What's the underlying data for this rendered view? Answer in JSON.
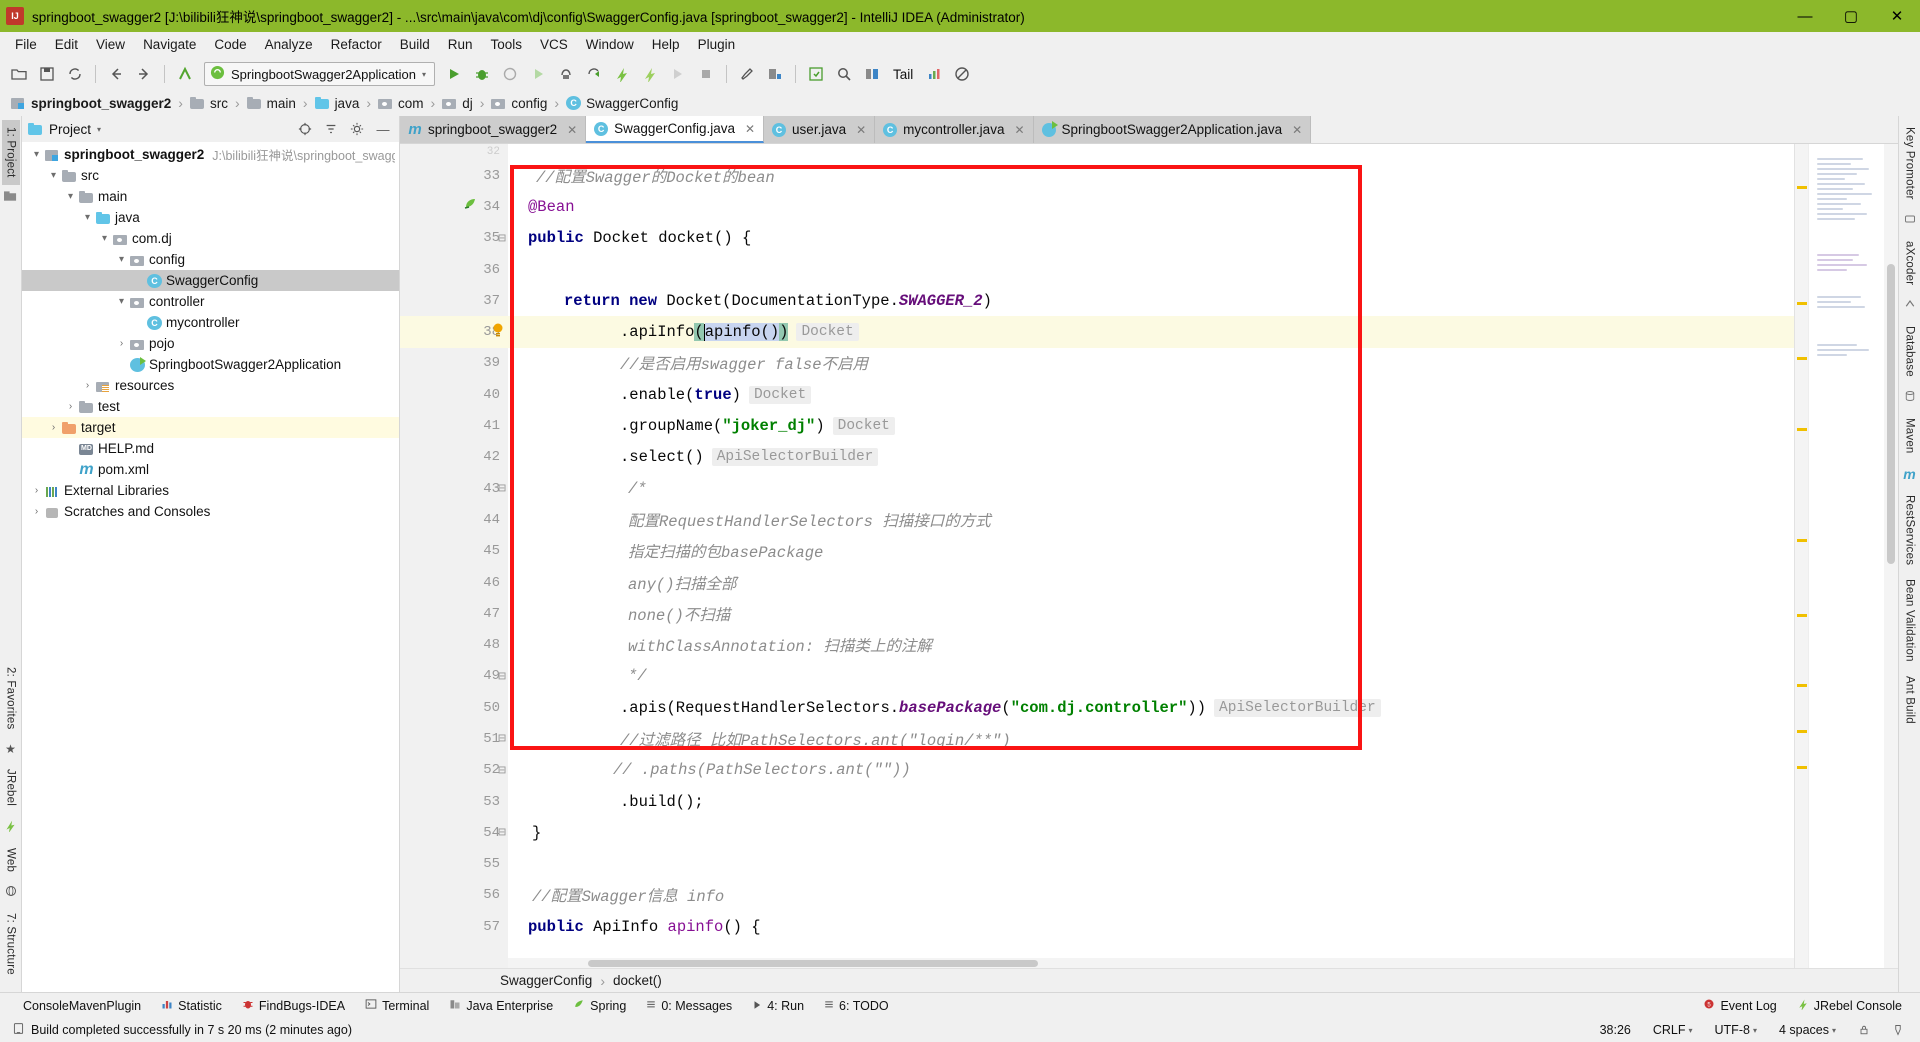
{
  "window": {
    "title": "springboot_swagger2 [J:\\bilibili狂神说\\springboot_swagger2] - ...\\src\\main\\java\\com\\dj\\config\\SwaggerConfig.java [springboot_swagger2] - IntelliJ IDEA (Administrator)",
    "minimize": "—",
    "maximize": "▢",
    "close": "✕",
    "app_icon": "intellij-idea-icon"
  },
  "menubar": {
    "items": [
      "File",
      "Edit",
      "View",
      "Navigate",
      "Code",
      "Analyze",
      "Refactor",
      "Build",
      "Run",
      "Tools",
      "VCS",
      "Window",
      "Help",
      "Plugin"
    ]
  },
  "toolbar": {
    "open_icon": "open-folder-icon",
    "save_icon": "save-icon",
    "sync_icon": "sync-icon",
    "back_icon": "back-arrow-icon",
    "forward_icon": "forward-arrow-icon",
    "revert_icon": "revert-icon",
    "run_config": "SpringbootSwagger2Application",
    "run_config_icon": "spring-boot-icon",
    "run_config_chevron": "chevron-down-icon",
    "run_icon": "run-icon",
    "debug_icon": "debug-icon",
    "run_coverage_icon": "run-with-coverage-icon",
    "profile_icon": "profile-icon",
    "attach_icon": "attach-debugger-icon",
    "rerun_icon": "rerun-icon",
    "jrebel_run_icon": "jrebel-run-icon",
    "jrebel_debug_icon": "jrebel-debug-icon",
    "stop_gray_icon": "stop-disabled-icon",
    "stop_icon": "stop-icon",
    "settings_icon": "settings-wrench-icon",
    "project_structure_icon": "project-structure-icon",
    "update_icon": "update-project-icon",
    "search_icon": "search-everywhere-icon",
    "compare_icon": "compare-icon",
    "tail_label": "Tail",
    "chart_icon": "chart-icon",
    "block_icon": "no-entry-icon"
  },
  "breadcrumb": {
    "items": [
      {
        "label": "springboot_swagger2",
        "icon": "module-icon"
      },
      {
        "label": "src",
        "icon": "folder-icon"
      },
      {
        "label": "main",
        "icon": "folder-icon"
      },
      {
        "label": "java",
        "icon": "source-folder-icon"
      },
      {
        "label": "com",
        "icon": "package-icon"
      },
      {
        "label": "dj",
        "icon": "package-icon"
      },
      {
        "label": "config",
        "icon": "package-icon"
      },
      {
        "label": "SwaggerConfig",
        "icon": "class-icon"
      }
    ],
    "separator": "›"
  },
  "left_rail": {
    "items": [
      "1: Project",
      "2: Favorites",
      "7: Structure"
    ],
    "icons": [
      "project-icon",
      "star-icon",
      "structure-icon",
      "jrebel-icon",
      "web-icon"
    ]
  },
  "right_rail": {
    "items": [
      "Key Promoter",
      "aXcoder",
      "Database",
      "Maven",
      "RestServices",
      "Bean Validation",
      "Ant Build"
    ]
  },
  "project_panel": {
    "title": "Project",
    "title_chevron": "chevron-down-icon",
    "title_icon": "project-view-icon",
    "locate_icon": "scroll-from-source-icon",
    "collapse_icon": "collapse-all-icon",
    "settings_icon": "gear-icon",
    "hide_icon": "hide-icon",
    "tree": [
      {
        "label": "springboot_swagger2",
        "path": "J:\\bilibili狂神说\\springboot_swagg",
        "indent": 0,
        "twisty": "▾",
        "icon": "module-icon",
        "bold": true,
        "state": "normal"
      },
      {
        "label": "src",
        "indent": 1,
        "twisty": "▾",
        "icon": "folder-icon",
        "state": "normal"
      },
      {
        "label": "main",
        "indent": 2,
        "twisty": "▾",
        "icon": "folder-icon",
        "state": "normal"
      },
      {
        "label": "java",
        "indent": 3,
        "twisty": "▾",
        "icon": "source-folder-icon",
        "state": "normal"
      },
      {
        "label": "com.dj",
        "indent": 4,
        "twisty": "▾",
        "icon": "package-icon",
        "state": "normal"
      },
      {
        "label": "config",
        "indent": 5,
        "twisty": "▾",
        "icon": "package-icon",
        "state": "normal"
      },
      {
        "label": "SwaggerConfig",
        "indent": 6,
        "twisty": "",
        "icon": "class-icon",
        "state": "selected"
      },
      {
        "label": "controller",
        "indent": 5,
        "twisty": "▾",
        "icon": "package-icon",
        "state": "normal"
      },
      {
        "label": "mycontroller",
        "indent": 6,
        "twisty": "",
        "icon": "class-icon",
        "state": "normal"
      },
      {
        "label": "pojo",
        "indent": 5,
        "twisty": "›",
        "icon": "package-icon",
        "state": "normal"
      },
      {
        "label": "SpringbootSwagger2Application",
        "indent": 5,
        "twisty": "",
        "icon": "spring-class-icon",
        "state": "normal"
      },
      {
        "label": "resources",
        "indent": 3,
        "twisty": "›",
        "icon": "resources-folder-icon",
        "state": "normal"
      },
      {
        "label": "test",
        "indent": 2,
        "twisty": "›",
        "icon": "folder-icon",
        "state": "normal"
      },
      {
        "label": "target",
        "indent": 1,
        "twisty": "›",
        "icon": "folder-orange-icon",
        "state": "highlighted"
      },
      {
        "label": "HELP.md",
        "indent": 2,
        "twisty": "",
        "icon": "markdown-icon",
        "state": "normal"
      },
      {
        "label": "pom.xml",
        "indent": 2,
        "twisty": "",
        "icon": "maven-icon",
        "state": "normal"
      },
      {
        "label": "External Libraries",
        "indent": 0,
        "twisty": "›",
        "icon": "libraries-icon",
        "state": "normal"
      },
      {
        "label": "Scratches and Consoles",
        "indent": 0,
        "twisty": "›",
        "icon": "scratches-icon",
        "state": "normal"
      }
    ]
  },
  "editor_tabs": [
    {
      "label": "springboot_swagger2",
      "icon": "maven-icon",
      "active": false,
      "close": "✕"
    },
    {
      "label": "SwaggerConfig.java",
      "icon": "class-icon",
      "active": true,
      "close": "✕"
    },
    {
      "label": "user.java",
      "icon": "class-icon",
      "active": false,
      "close": "✕"
    },
    {
      "label": "mycontroller.java",
      "icon": "class-icon",
      "active": false,
      "close": "✕"
    },
    {
      "label": "SpringbootSwagger2Application.java",
      "icon": "spring-class-icon",
      "active": false,
      "close": "✕"
    }
  ],
  "editor": {
    "first_visible_line": 32,
    "current_line": 38,
    "lines": [
      {
        "n": 33,
        "tokens": [
          {
            "t": "//配置Swagger的Docket的bean",
            "c": "cm"
          }
        ],
        "indent": 4
      },
      {
        "n": 34,
        "tokens": [
          {
            "t": "@Bean",
            "c": "fld"
          }
        ],
        "indent": 4,
        "gutter_icon": "spring-bean-icon"
      },
      {
        "n": 35,
        "tokens": [
          {
            "t": "public",
            "c": "kw"
          },
          {
            "t": " Docket docket() {",
            "c": ""
          }
        ],
        "indent": 4,
        "fold": "−"
      },
      {
        "n": 36,
        "tokens": [],
        "indent": 4
      },
      {
        "n": 37,
        "tokens": [
          {
            "t": "return",
            "c": "kw"
          },
          {
            "t": " ",
            "c": ""
          },
          {
            "t": "new",
            "c": "kw"
          },
          {
            "t": " Docket(DocumentationType.",
            "c": ""
          },
          {
            "t": "SWAGGER_2",
            "c": "stat"
          },
          {
            "t": ")",
            "c": ""
          }
        ],
        "indent": 8
      },
      {
        "n": 38,
        "tokens": [
          {
            "t": ".apiInfo",
            "c": ""
          },
          {
            "t": "(",
            "c": "brmatch"
          },
          {
            "t": "apinfo()",
            "c": "selbg"
          },
          {
            "t": ")",
            "c": "brmatch"
          }
        ],
        "hint": "Docket",
        "indent": 12,
        "current": true,
        "gutter_icon": "intention-bulb-icon"
      },
      {
        "n": 39,
        "tokens": [
          {
            "t": "//是否启用swagger false不启用",
            "c": "cm"
          }
        ],
        "indent": 12
      },
      {
        "n": 40,
        "tokens": [
          {
            "t": ".enable(",
            "c": ""
          },
          {
            "t": "true",
            "c": "kw"
          },
          {
            "t": ")",
            "c": ""
          }
        ],
        "hint": "Docket",
        "indent": 12
      },
      {
        "n": 41,
        "tokens": [
          {
            "t": ".groupName(",
            "c": ""
          },
          {
            "t": "\"joker_dj\"",
            "c": "str"
          },
          {
            "t": ")",
            "c": ""
          }
        ],
        "hint": "Docket",
        "indent": 12
      },
      {
        "n": 42,
        "tokens": [
          {
            "t": ".select()",
            "c": ""
          }
        ],
        "hint": "ApiSelectorBuilder",
        "indent": 12
      },
      {
        "n": 43,
        "tokens": [
          {
            "t": "/*",
            "c": "cm"
          }
        ],
        "indent": 12,
        "fold": "−"
      },
      {
        "n": 44,
        "tokens": [
          {
            "t": "配置RequestHandlerSelectors 扫描接口的方式",
            "c": "cm"
          }
        ],
        "indent": 12
      },
      {
        "n": 45,
        "tokens": [
          {
            "t": "指定扫描的包basePackage",
            "c": "cm"
          }
        ],
        "indent": 12
      },
      {
        "n": 46,
        "tokens": [
          {
            "t": "any()扫描全部",
            "c": "cm"
          }
        ],
        "indent": 12
      },
      {
        "n": 47,
        "tokens": [
          {
            "t": "none()不扫描",
            "c": "cm"
          }
        ],
        "indent": 12
      },
      {
        "n": 48,
        "tokens": [
          {
            "t": "withClassAnnotation: 扫描类上的注解",
            "c": "cm"
          }
        ],
        "indent": 12
      },
      {
        "n": 49,
        "tokens": [
          {
            "t": "*/",
            "c": "cm"
          }
        ],
        "indent": 12,
        "fold": "−"
      },
      {
        "n": 50,
        "tokens": [
          {
            "t": ".apis(RequestHandlerSelectors.",
            "c": ""
          },
          {
            "t": "basePackage",
            "c": "stat"
          },
          {
            "t": "(",
            "c": ""
          },
          {
            "t": "\"com.dj.controller\"",
            "c": "str"
          },
          {
            "t": "))",
            "c": ""
          }
        ],
        "hint": "ApiSelectorBuilder",
        "indent": 12
      },
      {
        "n": 51,
        "tokens": [
          {
            "t": "//过滤路径 比如PathSelectors.ant(\"login/**\")",
            "c": "cm"
          }
        ],
        "indent": 12,
        "fold": "−"
      },
      {
        "n": 52,
        "tokens": [
          {
            "t": "// .paths(PathSelectors.ant(\"\"))",
            "c": "cm"
          }
        ],
        "indent": 10,
        "fold": "−"
      },
      {
        "n": 53,
        "tokens": [
          {
            "t": ".build();",
            "c": ""
          }
        ],
        "indent": 12
      },
      {
        "n": 54,
        "tokens": [
          {
            "t": "}",
            "c": ""
          }
        ],
        "indent": 4,
        "fold": "−"
      },
      {
        "n": 55,
        "tokens": [],
        "indent": 4
      },
      {
        "n": 56,
        "tokens": [
          {
            "t": "//配置Swagger信息 info",
            "c": "cm"
          }
        ],
        "indent": 4
      },
      {
        "n": 57,
        "tokens": [
          {
            "t": "public",
            "c": "kw"
          },
          {
            "t": " ApiInfo ",
            "c": ""
          },
          {
            "t": "apinfo",
            "c": "fld"
          },
          {
            "t": "() {",
            "c": ""
          }
        ],
        "indent": 4
      }
    ],
    "annotation_box_color": "#fa1414",
    "footer_breadcrumb": [
      "SwaggerConfig",
      "docket()"
    ],
    "footer_separator": "›"
  },
  "tool_windows": {
    "left_items": [
      {
        "label": "ConsoleMavenPlugin",
        "icon": "maven-console-icon"
      },
      {
        "label": "Statistic",
        "icon": "statistic-icon"
      },
      {
        "label": "FindBugs-IDEA",
        "icon": "findbugs-icon"
      },
      {
        "label": "Terminal",
        "icon": "terminal-icon"
      },
      {
        "label": "Java Enterprise",
        "icon": "java-enterprise-icon"
      },
      {
        "label": "Spring",
        "icon": "spring-icon"
      },
      {
        "label": "0: Messages",
        "icon": "messages-icon"
      },
      {
        "label": "4: Run",
        "icon": "run-icon"
      },
      {
        "label": "6: TODO",
        "icon": "todo-icon"
      }
    ],
    "right_items": [
      {
        "label": "Event Log",
        "icon": "event-log-icon"
      },
      {
        "label": "JRebel Console",
        "icon": "jrebel-icon"
      }
    ]
  },
  "status_bar": {
    "message_icon": "build-icon",
    "message": "Build completed successfully in 7 s 20 ms (2 minutes ago)",
    "caret_position": "38:26",
    "line_separator": "CRLF",
    "encoding": "UTF-8",
    "indent": "4 spaces",
    "lock_icon": "lock-icon",
    "memory_icon": "inspection-icon",
    "chevron": "▾"
  },
  "colors": {
    "title_bar": "#8cb82b",
    "panel": "#f0f0f0",
    "selection": "#c9c9c9",
    "current_line": "#fcfae2",
    "annotation_red": "#fa1414",
    "accent_blue": "#4a90d9"
  }
}
